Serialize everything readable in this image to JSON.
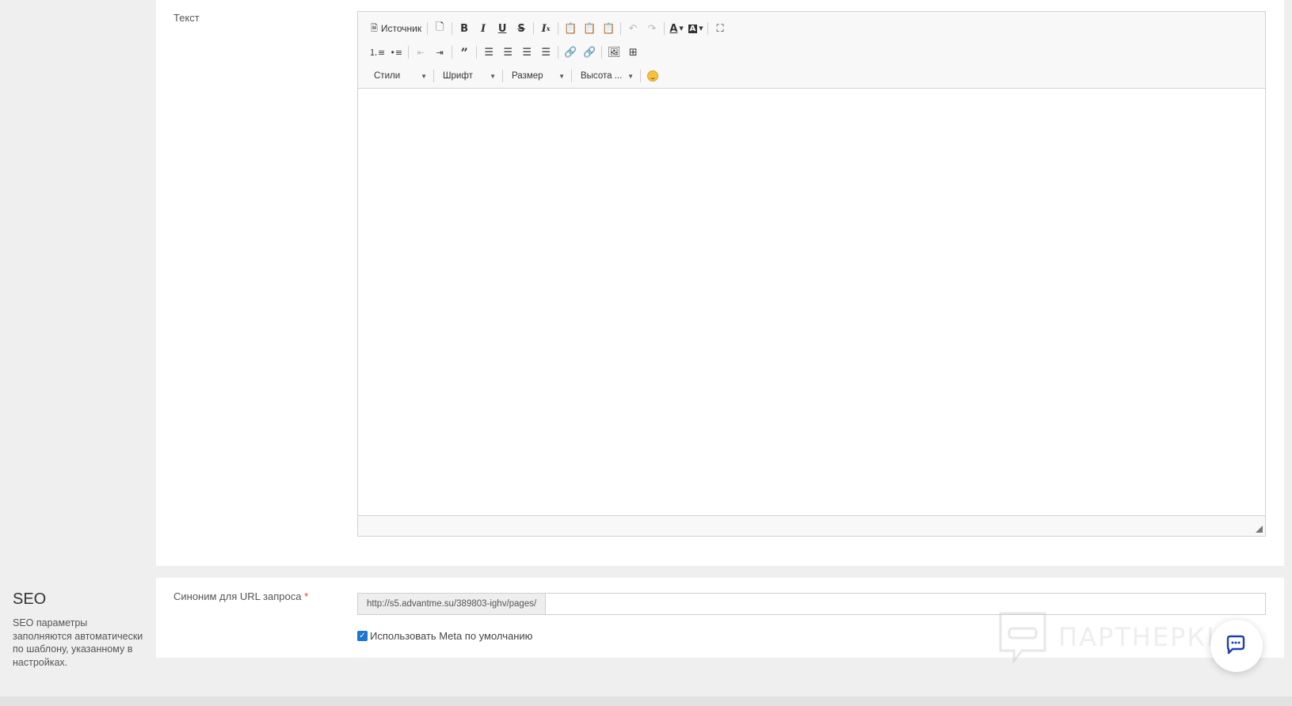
{
  "text_field": {
    "label": "Текст",
    "toolbar": {
      "source_label": "Источник",
      "combos": [
        "Стили",
        "Шрифт",
        "Размер",
        "Высота ..."
      ]
    }
  },
  "seo": {
    "title": "SEO",
    "description": "SEO параметры заполняются автоматически по шаблону, указанному в настройках.",
    "url_label": "Синоним для URL запроса",
    "required_mark": "*",
    "url_prefix": "http://s5.advantme.su/389803-ighv/pages/",
    "url_value": "",
    "use_default_meta_label": "Использовать Meta по умолчанию",
    "use_default_meta_checked": true
  },
  "watermark": {
    "text": "ПАРТНЕРКИН"
  },
  "colors": {
    "accent": "#1976d2",
    "required": "#e53935",
    "page_bg": "#efefef"
  }
}
